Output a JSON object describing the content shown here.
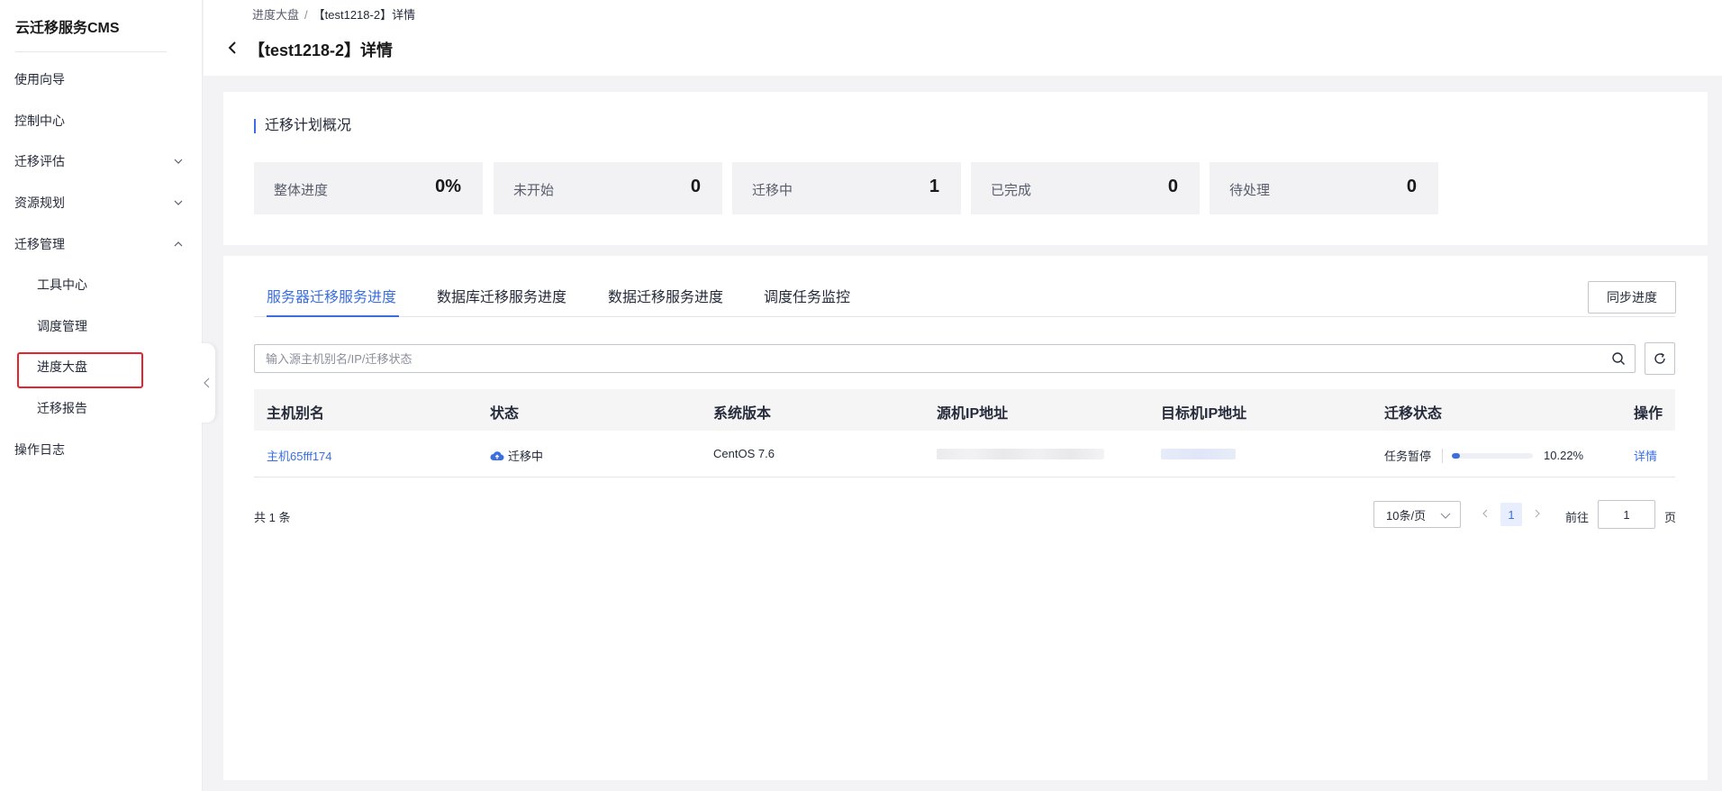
{
  "app": {
    "title": "云迁移服务CMS"
  },
  "sidebar": {
    "items": [
      {
        "label": "使用向导"
      },
      {
        "label": "控制中心"
      },
      {
        "label": "迁移评估"
      },
      {
        "label": "资源规划"
      },
      {
        "label": "迁移管理"
      }
    ],
    "sub_items": [
      {
        "label": "工具中心"
      },
      {
        "label": "调度管理"
      },
      {
        "label": "进度大盘"
      },
      {
        "label": "迁移报告"
      }
    ],
    "footer_item": {
      "label": "操作日志"
    }
  },
  "header": {
    "breadcrumb": {
      "parent": "进度大盘",
      "separator": "/",
      "current": "【test1218-2】详情"
    },
    "title": "【test1218-2】详情"
  },
  "overview": {
    "title": "迁移计划概况",
    "stats": [
      {
        "label": "整体进度",
        "value": "0%"
      },
      {
        "label": "未开始",
        "value": "0"
      },
      {
        "label": "迁移中",
        "value": "1"
      },
      {
        "label": "已完成",
        "value": "0"
      },
      {
        "label": "待处理",
        "value": "0"
      }
    ]
  },
  "tabs": [
    {
      "label": "服务器迁移服务进度"
    },
    {
      "label": "数据库迁移服务进度"
    },
    {
      "label": "数据迁移服务进度"
    },
    {
      "label": "调度任务监控"
    }
  ],
  "actions": {
    "sync_label": "同步进度"
  },
  "search": {
    "placeholder": "输入源主机别名/IP/迁移状态",
    "value": ""
  },
  "table": {
    "columns": [
      "主机别名",
      "状态",
      "系统版本",
      "源机IP地址",
      "目标机IP地址",
      "迁移状态",
      "操作"
    ],
    "rows": [
      {
        "alias": "主机65fff174",
        "status": "迁移中",
        "os": "CentOS 7.6",
        "mig_state": "任务暂停",
        "progress_pct": 10.22,
        "progress_text": "10.22%",
        "action": "详情"
      }
    ]
  },
  "pagination": {
    "total_text": "共 1 条",
    "page_size": "10条/页",
    "current_page": "1",
    "goto_label": "前往",
    "goto_value": "1",
    "page_unit": "页"
  },
  "colors": {
    "accent": "#3b6fe0",
    "highlight": "#e8232e"
  }
}
